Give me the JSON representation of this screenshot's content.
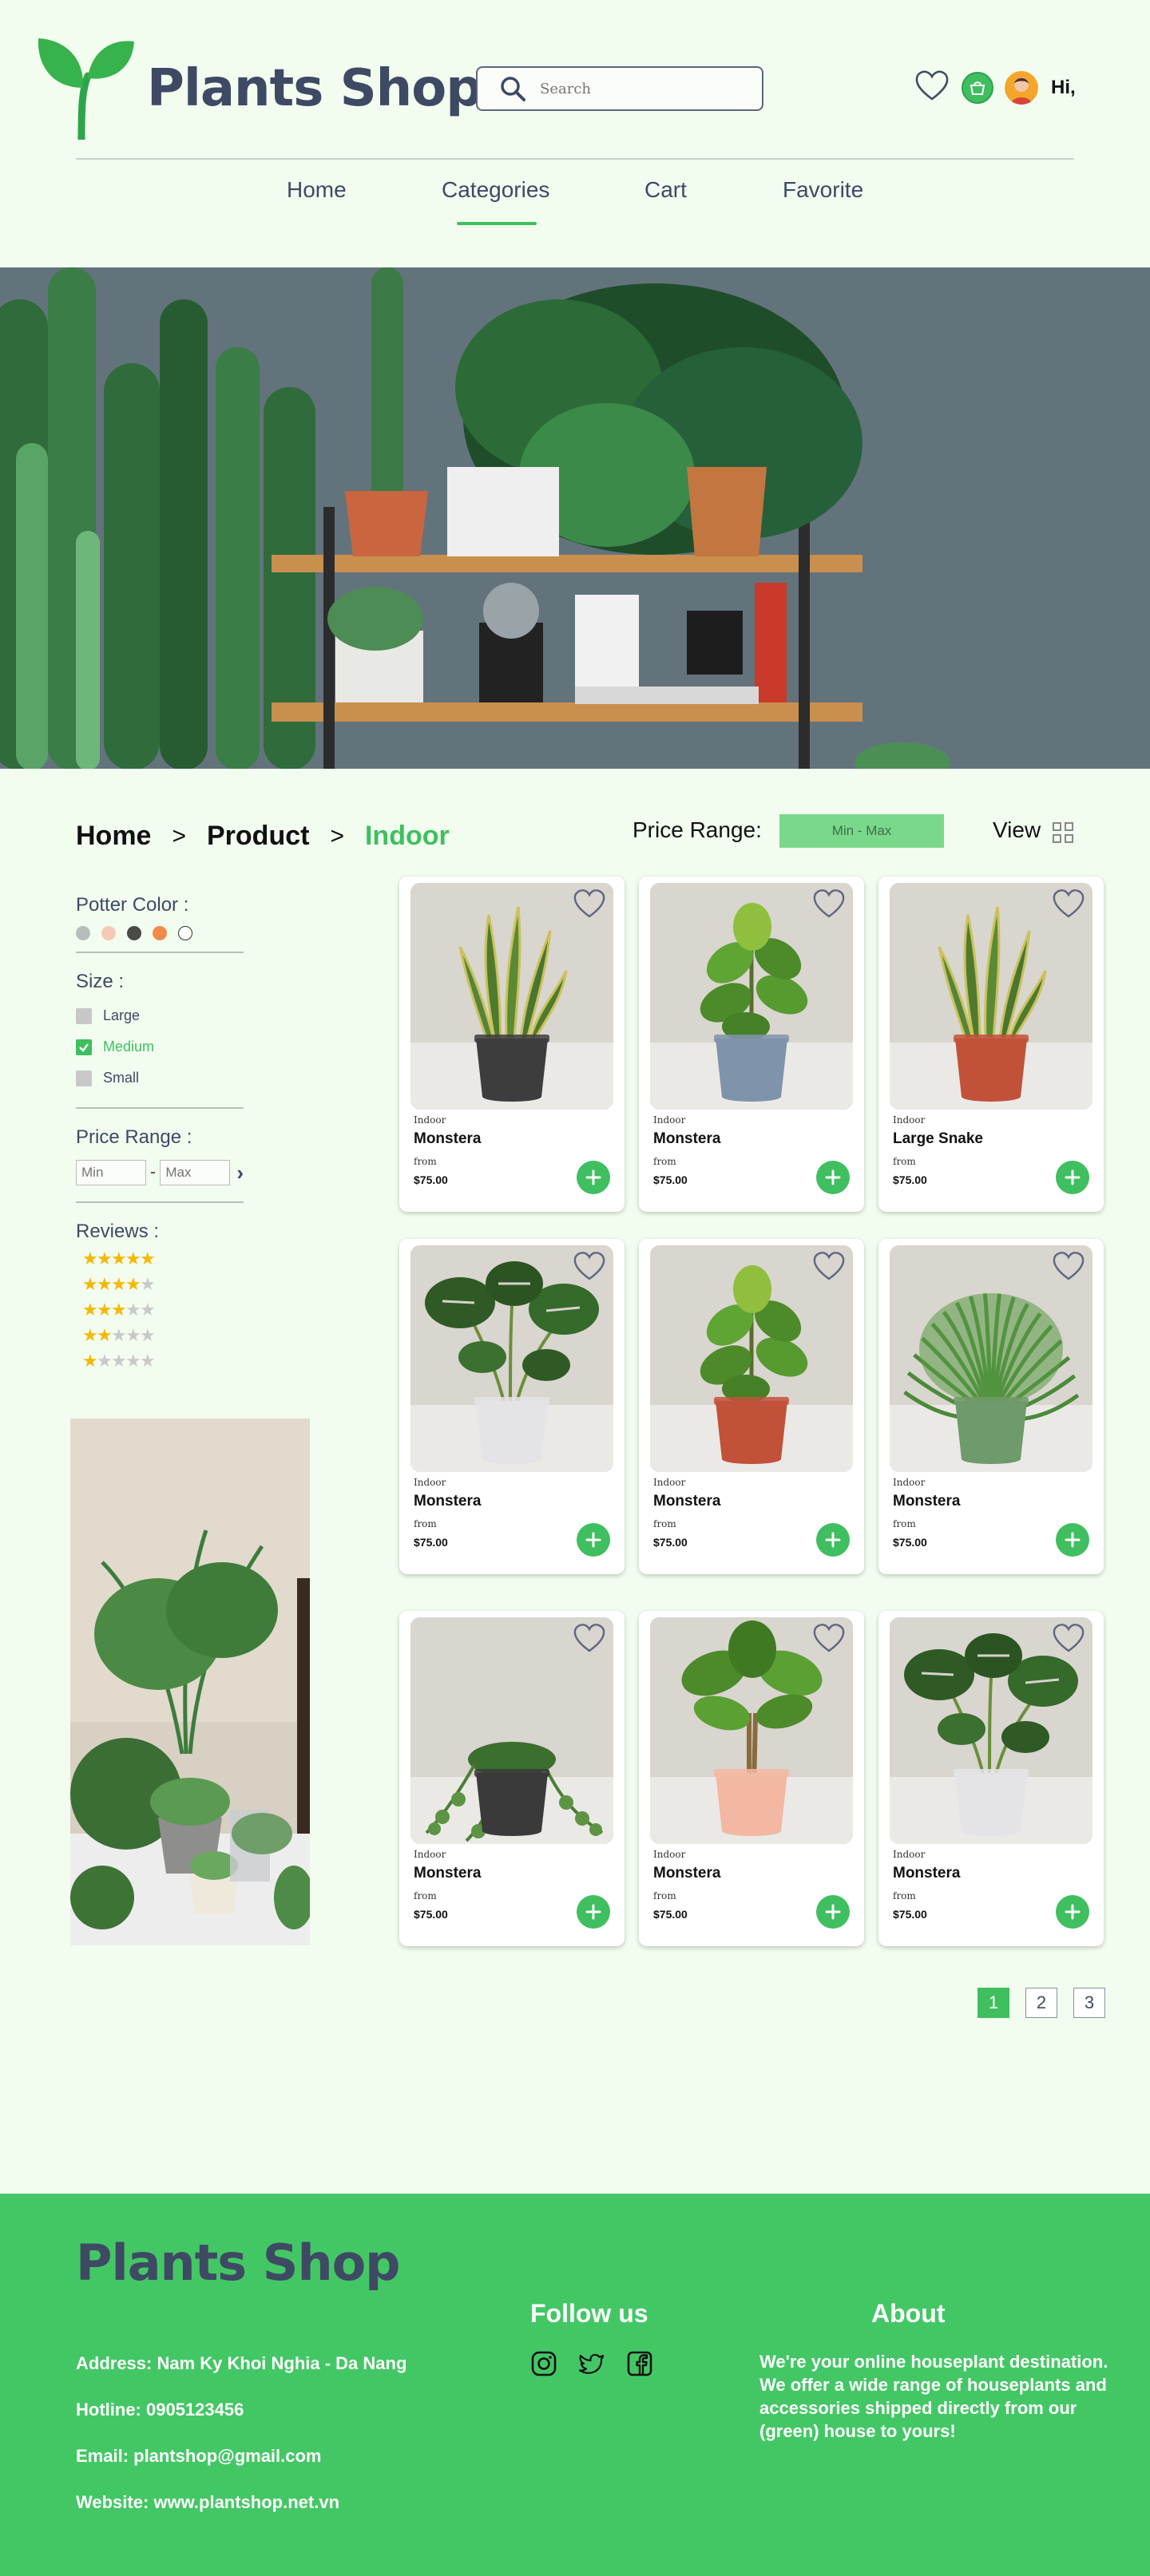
{
  "brand": {
    "name": "Plants Shop"
  },
  "search": {
    "placeholder": "Search"
  },
  "header": {
    "greeting": "Hi,"
  },
  "nav": {
    "items": [
      "Home",
      "Categories",
      "Cart",
      "Favorite"
    ],
    "active": "Categories"
  },
  "breadcrumb": {
    "items": [
      "Home",
      "Product",
      "Indoor"
    ],
    "separator": ">"
  },
  "toolbar": {
    "price_range_label": "Price Range:",
    "price_range_value": "Min - Max",
    "view_label": "View"
  },
  "filters": {
    "potter_color_label": "Potter Color :",
    "potter_colors": [
      "#b8bcbb",
      "#f6c9b7",
      "#4a4a4a",
      "#f28a4a",
      "#ffffff"
    ],
    "size_label": "Size :",
    "sizes": [
      {
        "label": "Large",
        "checked": false
      },
      {
        "label": "Medium",
        "checked": true
      },
      {
        "label": "Small",
        "checked": false
      }
    ],
    "price_range_label": "Price Range :",
    "min_placeholder": "Min",
    "max_placeholder": "Max",
    "reviews_label": "Reviews :",
    "review_ratings": [
      5,
      4,
      3,
      2,
      1
    ]
  },
  "products": [
    {
      "category": "Indoor",
      "name": "Monstera",
      "from_label": "from",
      "price": "$75.00",
      "plant": "snake",
      "pot": "#3d3d3d"
    },
    {
      "category": "Indoor",
      "name": "Monstera",
      "from_label": "from",
      "price": "$75.00",
      "plant": "fiddle",
      "pot": "#7f93ab"
    },
    {
      "category": "Indoor",
      "name": "Large Snake",
      "from_label": "from",
      "price": "$75.00",
      "plant": "snake",
      "pot": "#c2513a"
    },
    {
      "category": "Indoor",
      "name": "Monstera",
      "from_label": "from",
      "price": "$75.00",
      "plant": "monstera",
      "pot": "#e4e4e6"
    },
    {
      "category": "Indoor",
      "name": "Monstera",
      "from_label": "from",
      "price": "$75.00",
      "plant": "fiddle",
      "pot": "#c2513a"
    },
    {
      "category": "Indoor",
      "name": "Monstera",
      "from_label": "from",
      "price": "$75.00",
      "plant": "fern",
      "pot": "#6f9a6b"
    },
    {
      "category": "Indoor",
      "name": "Monstera",
      "from_label": "from",
      "price": "$75.00",
      "plant": "trailing",
      "pot": "#3a3a3a"
    },
    {
      "category": "Indoor",
      "name": "Monstera",
      "from_label": "from",
      "price": "$75.00",
      "plant": "money",
      "pot": "#f2b8a3"
    },
    {
      "category": "Indoor",
      "name": "Monstera",
      "from_label": "from",
      "price": "$75.00",
      "plant": "monstera",
      "pot": "#e4e4e6"
    }
  ],
  "pagination": {
    "pages": [
      "1",
      "2",
      "3"
    ],
    "current": "1"
  },
  "footer": {
    "brand": "Plants Shop",
    "address": "Address: Nam Ky Khoi Nghia - Da Nang",
    "hotline": "Hotline: 0905123456",
    "email": "Email: plantshop@gmail.com",
    "website": "Website: www.plantshop.net.vn",
    "follow_heading": "Follow us",
    "social": [
      "instagram-icon",
      "twitter-icon",
      "facebook-icon"
    ],
    "about_heading": "About",
    "about_text": "We're your online houseplant destination. We offer a wide range of houseplants and accessories shipped directly from our (green) house to yours!"
  },
  "colors": {
    "accent": "#3fbf5f",
    "navy": "#3e4a63",
    "page_bg": "#f2fdf0"
  }
}
